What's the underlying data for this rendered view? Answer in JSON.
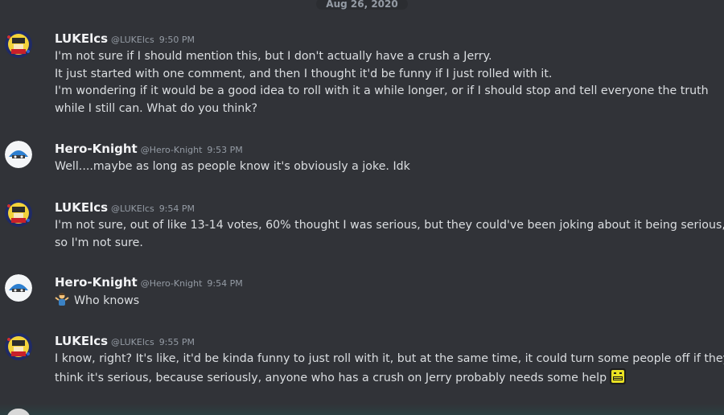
{
  "date_divider": "Aug 26, 2020",
  "colors": {
    "background": "#313338",
    "username": "#f2f3f5",
    "meta": "#949ba4",
    "text": "#dbdee1"
  },
  "messages": [
    {
      "avatar_icon": "luke-avatar-icon",
      "username": "LUKElcs",
      "handle": "@LUKElcs",
      "time": "9:50 PM",
      "lines": [
        "I'm not sure if I should mention this, but I don't actually have a crush a Jerry.",
        "It just started with one comment, and then I thought it'd be funny if I just rolled with it.",
        "I'm wondering if it would be a good idea to roll with it a while longer, or if I should stop and tell everyone the truth",
        "while I still can. What do you think?"
      ]
    },
    {
      "avatar_icon": "hero-knight-avatar-icon",
      "username": "Hero-Knight",
      "handle": "@Hero-Knight",
      "time": "9:53 PM",
      "lines": [
        "Well....maybe as long as people know it's obviously a joke. Idk"
      ]
    },
    {
      "avatar_icon": "luke-avatar-icon",
      "username": "LUKElcs",
      "handle": "@LUKElcs",
      "time": "9:54 PM",
      "lines": [
        "I'm not sure, out of like 13-14 votes, 60% thought I was serious, but they could've been joking about it being serious,",
        "so I'm not sure."
      ]
    },
    {
      "avatar_icon": "hero-knight-avatar-icon",
      "username": "Hero-Knight",
      "handle": "@Hero-Knight",
      "time": "9:54 PM",
      "emoji": "person-shrugging-emoji",
      "lines": [
        "Who knows"
      ]
    },
    {
      "avatar_icon": "luke-avatar-icon",
      "username": "LUKElcs",
      "handle": "@LUKElcs",
      "time": "9:55 PM",
      "trailing_emoji": "grimace-emoji",
      "lines": [
        "I know, right? It's like, it'd be kinda funny to just roll with it, but at the same time, it could turn some people off if they",
        "think it's serious, because seriously, anyone who has a crush on Jerry probably needs some help"
      ]
    }
  ]
}
